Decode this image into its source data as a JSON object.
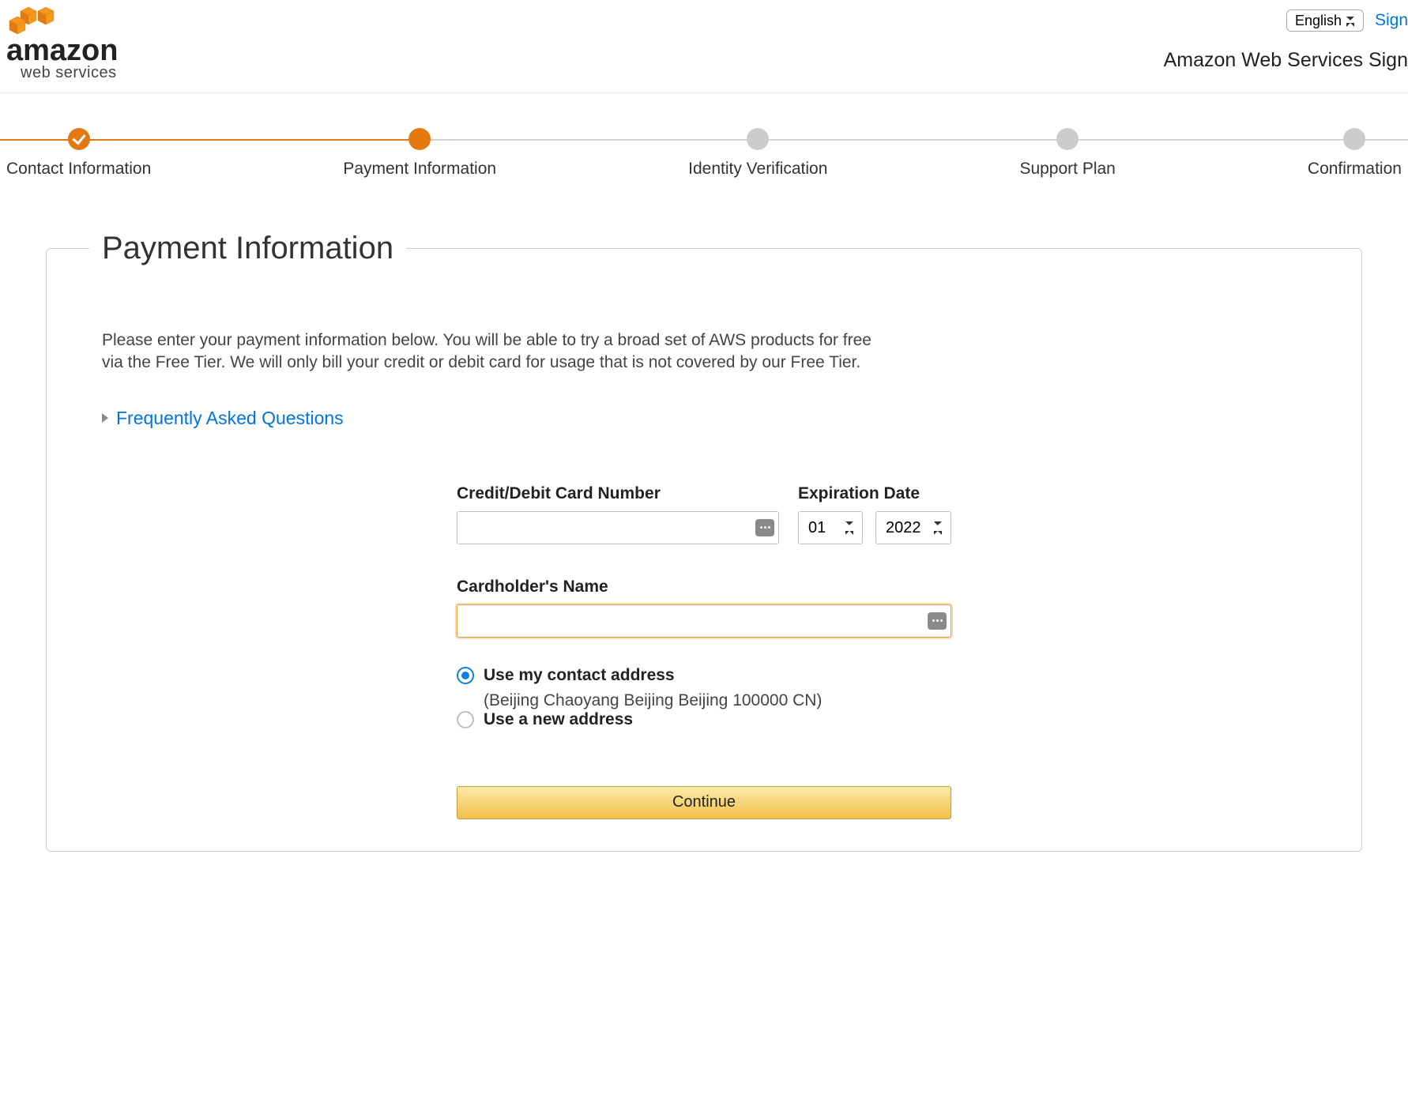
{
  "header": {
    "logo": {
      "line1": "amazon",
      "line2": "web services"
    },
    "language": "English",
    "sign_link": "Sign",
    "tagline": "Amazon Web Services Sign"
  },
  "stepper": {
    "steps": [
      {
        "label": "Contact Information",
        "state": "done"
      },
      {
        "label": "Payment Information",
        "state": "active"
      },
      {
        "label": "Identity Verification",
        "state": "todo"
      },
      {
        "label": "Support Plan",
        "state": "todo"
      },
      {
        "label": "Confirmation",
        "state": "todo"
      }
    ]
  },
  "panel": {
    "title": "Payment Information",
    "intro": "Please enter your payment information below. You will be able to try a broad set of AWS products for free via the Free Tier. We will only bill your credit or debit card for usage that is not covered by our Free Tier.",
    "faq_label": "Frequently Asked Questions"
  },
  "form": {
    "card_label": "Credit/Debit Card Number",
    "card_value": "",
    "exp_label": "Expiration Date",
    "exp_month": "01",
    "exp_year": "2022",
    "name_label": "Cardholder's Name",
    "name_value": "",
    "addr_contact_label": "Use my contact address",
    "addr_contact_sub": "(Beijing Chaoyang Beijing Beijing 100000 CN)",
    "addr_new_label": "Use a new address",
    "continue_label": "Continue"
  }
}
